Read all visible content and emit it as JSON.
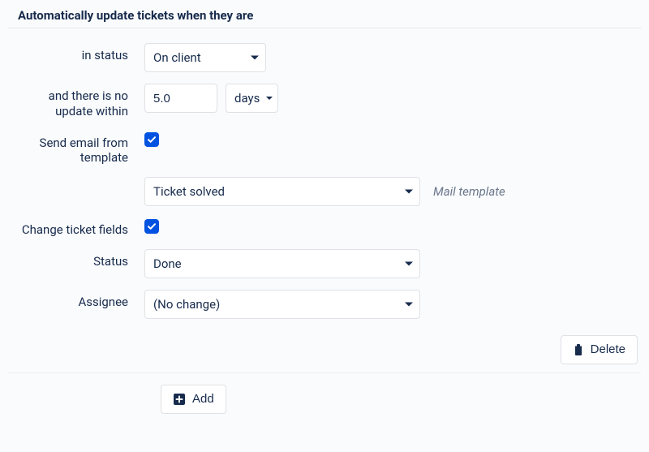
{
  "section_title": "Automatically update tickets when they are",
  "labels": {
    "in_status": "in status",
    "no_update_within": "and there is no update within",
    "send_email": "Send email from template",
    "change_fields": "Change ticket fields",
    "status": "Status",
    "assignee": "Assignee"
  },
  "values": {
    "status_filter": "On client",
    "duration_value": "5.0",
    "duration_unit": "days",
    "send_email_checked": true,
    "mail_template": "Ticket solved",
    "change_fields_checked": true,
    "status_new": "Done",
    "assignee_new": "(No change)"
  },
  "hints": {
    "mail_template": "Mail template"
  },
  "buttons": {
    "delete": "Delete",
    "add": "Add"
  }
}
